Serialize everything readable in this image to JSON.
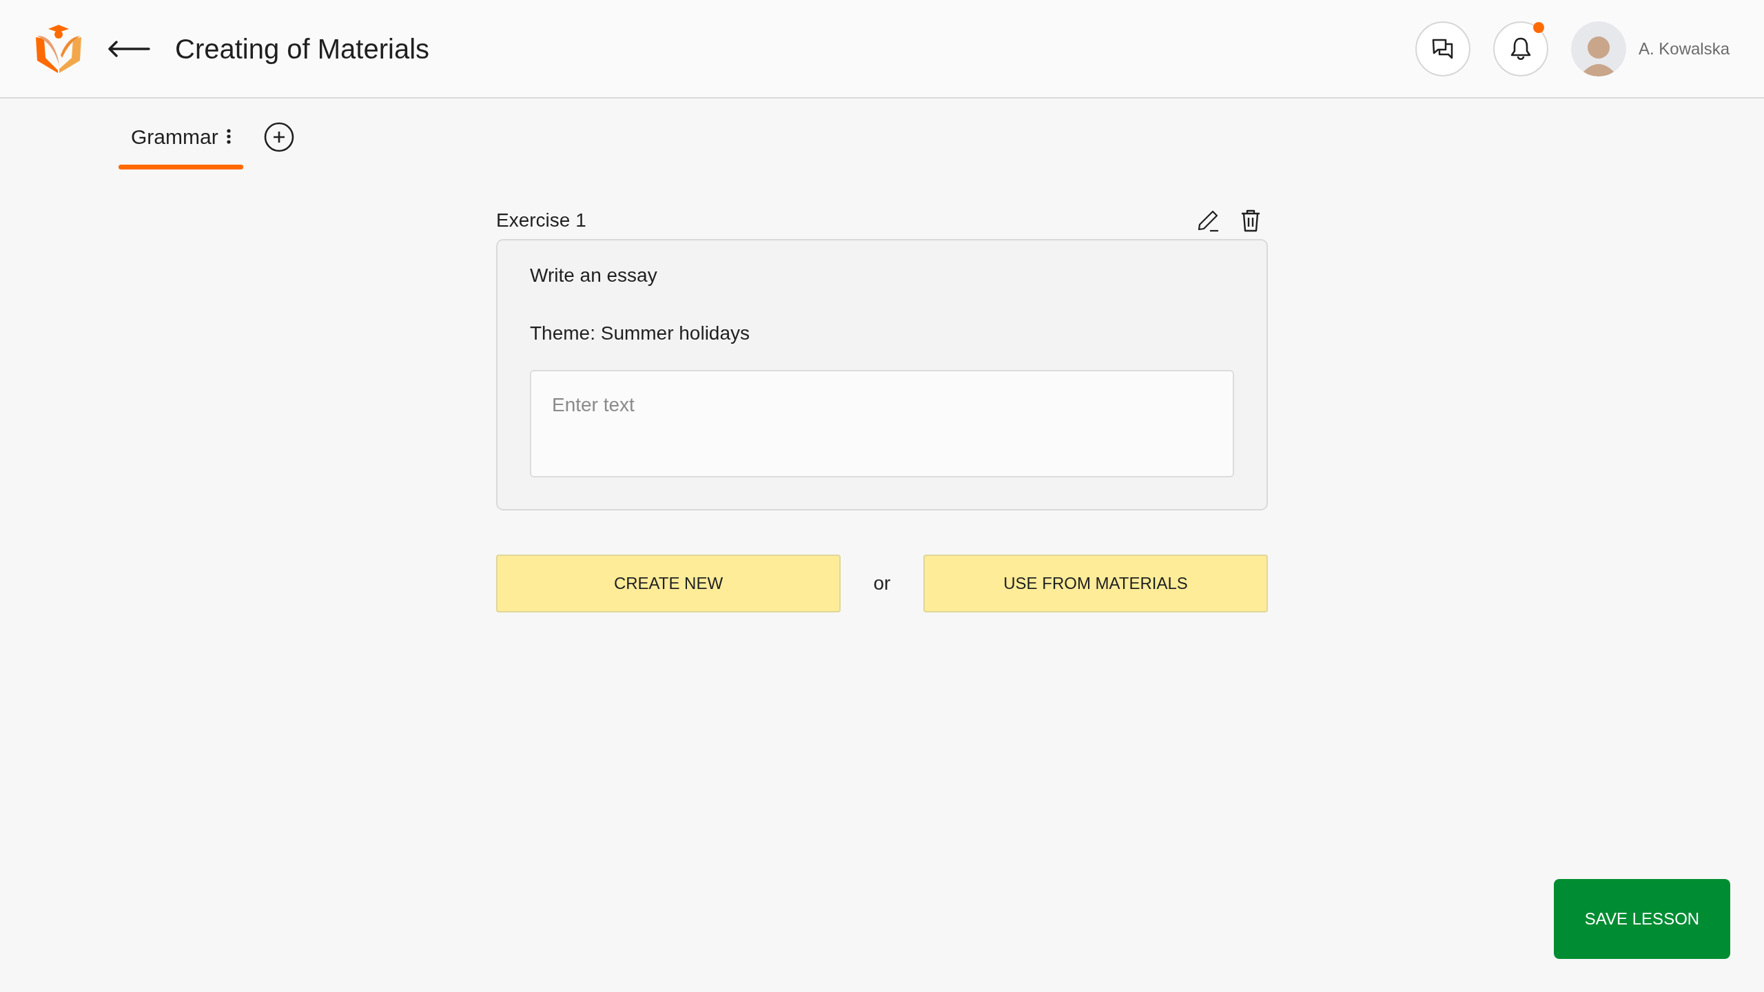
{
  "header": {
    "title": "Creating of Materials",
    "notifications": {
      "unread": true
    },
    "user": {
      "name": "A. Kowalska"
    }
  },
  "tabs": [
    {
      "label": "Grammar",
      "selected": true
    }
  ],
  "exercise": {
    "title": "Exercise 1",
    "task": "Write an essay",
    "theme": "Theme: Summer holidays",
    "answer": {
      "placeholder": "Enter text"
    }
  },
  "actions": {
    "create": "CREATE NEW",
    "separator": "or",
    "use": "USE FROM MATERIALS"
  },
  "save_button": "SAVE LESSON"
}
